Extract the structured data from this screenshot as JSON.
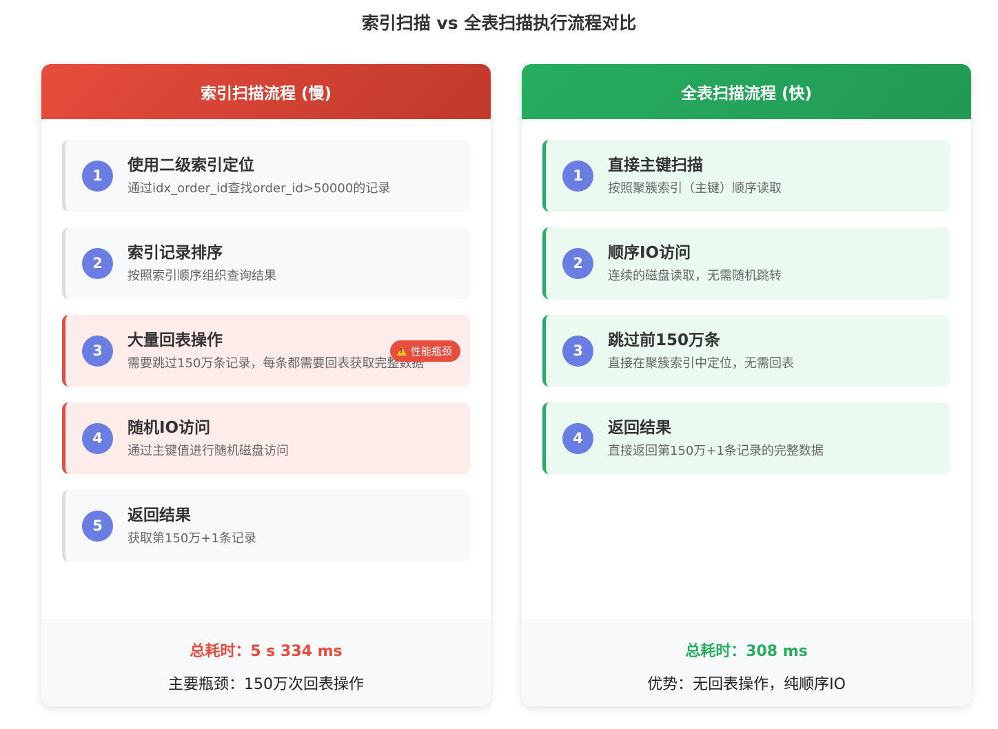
{
  "title": "索引扫描 vs 全表扫描执行流程对比",
  "left": {
    "header": "索引扫描流程 (慢)",
    "steps": [
      {
        "num": "1",
        "title": "使用二级索引定位",
        "desc": "通过idx_order_id查找order_id>50000的记录",
        "style": "neutral"
      },
      {
        "num": "2",
        "title": "索引记录排序",
        "desc": "按照索引顺序组织查询结果",
        "style": "neutral"
      },
      {
        "num": "3",
        "title": "大量回表操作",
        "desc": "需要跳过150万条记录，每条都需要回表获取完整数据",
        "style": "bad",
        "badge": "性能瓶颈"
      },
      {
        "num": "4",
        "title": "随机IO访问",
        "desc": "通过主键值进行随机磁盘访问",
        "style": "bad"
      },
      {
        "num": "5",
        "title": "返回结果",
        "desc": "获取第150万+1条记录",
        "style": "neutral"
      }
    ],
    "footer_time": "总耗时：5 s 334 ms",
    "footer_note": "主要瓶颈：150万次回表操作"
  },
  "right": {
    "header": "全表扫描流程 (快)",
    "steps": [
      {
        "num": "1",
        "title": "直接主键扫描",
        "desc": "按照聚簇索引（主键）顺序读取",
        "style": "good"
      },
      {
        "num": "2",
        "title": "顺序IO访问",
        "desc": "连续的磁盘读取，无需随机跳转",
        "style": "good"
      },
      {
        "num": "3",
        "title": "跳过前150万条",
        "desc": "直接在聚簇索引中定位，无需回表",
        "style": "good"
      },
      {
        "num": "4",
        "title": "返回结果",
        "desc": "直接返回第150万+1条记录的完整数据",
        "style": "good"
      }
    ],
    "footer_time": "总耗时：308 ms",
    "footer_note": "优势：无回表操作，纯顺序IO"
  }
}
